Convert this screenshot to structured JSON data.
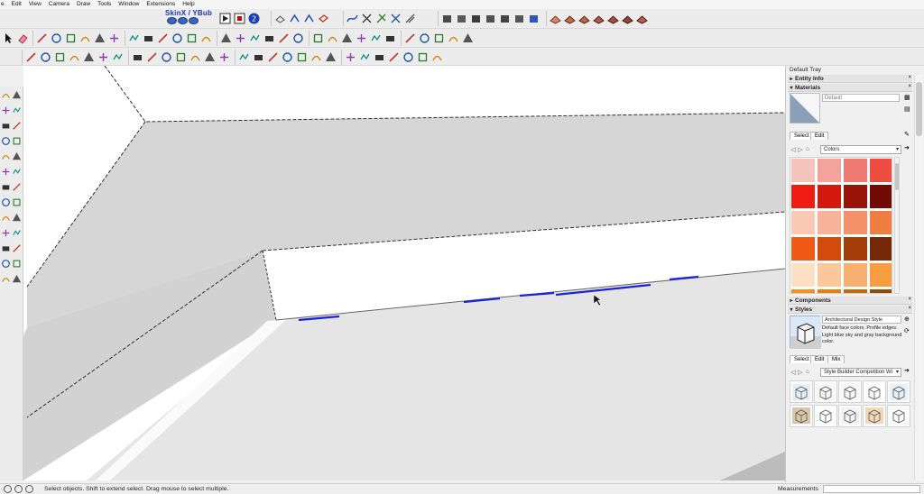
{
  "menu": {
    "items": [
      "e",
      "Edit",
      "View",
      "Camera",
      "Draw",
      "Tools",
      "Window",
      "Extensions",
      "Help"
    ]
  },
  "plugin": {
    "label": "SkinX / YBub"
  },
  "toolbar_icons": {
    "row1": [
      "pencil-icon",
      "arc-icon",
      "push-pull-icon",
      "circle-icon",
      "move-icon",
      "rotate-icon",
      "offset-icon",
      "tape-measure-icon",
      "text-icon",
      "axes-icon",
      "section-plane-icon",
      "paint-bucket-icon",
      "orbit-icon",
      "pan-icon",
      "zoom-icon",
      "zoom-extents-icon",
      "warehouse-icon",
      "extension-icon",
      "layout-icon",
      "style-shaded-icon",
      "style-wireframe-icon",
      "camera-position-icon",
      "walk-icon",
      "look-around-icon",
      "section-fill-icon",
      "follow-me-icon",
      "protractor-icon",
      "dimension-icon",
      "geo-location-icon"
    ],
    "row2": [
      "component-icon",
      "group-icon",
      "outliner-icon",
      "materials-icon",
      "sandbox-icon",
      "solid-tools-icon",
      "intersect-icon",
      "union-icon",
      "subtract-icon",
      "trim-icon",
      "split-icon",
      "outer-shell-icon",
      "fredo-scale-icon",
      "joint-push-pull-icon",
      "round-corner-icon",
      "curviloft-icon",
      "bezier-spline-icon",
      "flowify-icon",
      "shape-bender-icon",
      "extrude-tools-icon",
      "weld-icon",
      "edge-tools-icon",
      "cleanup-icon",
      "quad-face-icon",
      "subdivide-icon",
      "artisan-icon",
      "vertex-tools-icon",
      "profile-builder-icon"
    ]
  },
  "tray": {
    "title": "Default Tray",
    "entity_info": "Entity Info",
    "materials": {
      "header": "Materials",
      "name_placeholder": "Default",
      "tab_select": "Select",
      "tab_edit": "Edit",
      "library": "Colors",
      "colors": [
        "#f7c4bd",
        "#f5a29b",
        "#f07a73",
        "#ee4c40",
        "#ef1d12",
        "#d41a10",
        "#9a1208",
        "#6f0b03",
        "#fbc9b3",
        "#f8b49a",
        "#f4926c",
        "#f07e42",
        "#f05a14",
        "#d24a0c",
        "#a53d09",
        "#742805",
        "#fde0c3",
        "#fbc79b",
        "#f8b070",
        "#f69d40",
        "#f78f1f",
        "#e3800f",
        "#c26a09",
        "#8e4d07"
      ]
    },
    "components": {
      "header": "Components"
    },
    "styles": {
      "header": "Styles",
      "name": "Architectural Design Style",
      "description": "Default face colors. Profile edges. Light blue sky and gray background color.",
      "tab_select": "Select",
      "tab_edit": "Edit",
      "tab_mix": "Mix",
      "library": "Style Builder Competition Wi",
      "thumbnails": [
        "sketch-style-blue",
        "sketch-style-plain",
        "sketch-style-box",
        "sketch-style-outline",
        "sketch-style-light-blue",
        "sketch-style-sepia",
        "sketch-style-bw",
        "sketch-style-gray",
        "sketch-style-color",
        "sketch-style-faint"
      ]
    }
  },
  "status": {
    "hint": "Select objects. Shift to extend select. Drag mouse to select multiple.",
    "measurements_label": "Measurements",
    "measurements_value": ""
  },
  "colors": {
    "selection_blue": "#1a24d8",
    "face_gray": "#d6d6d6",
    "face_light": "#e5e5e5",
    "viewport_bg": "#ffffff"
  }
}
